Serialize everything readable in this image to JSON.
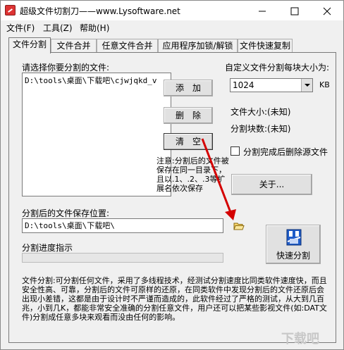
{
  "window": {
    "title": "超级文件切割刀——www.Lysoftware.net",
    "controls": [
      "minimize",
      "maximize",
      "close"
    ]
  },
  "menu": {
    "items": [
      {
        "label": "文件(F)"
      },
      {
        "label": "工具(Z)"
      },
      {
        "label": "帮助(H)"
      }
    ]
  },
  "tabs": [
    {
      "label": "文件分割",
      "active": true
    },
    {
      "label": "文件合并",
      "active": false
    },
    {
      "label": "任意文件合并",
      "active": false
    },
    {
      "label": "应用程序加锁/解锁",
      "active": false
    },
    {
      "label": "文件快速复制",
      "active": false
    }
  ],
  "split_panel": {
    "select_files_label": "请选择你要分割的文件:",
    "file_list": [
      "D:\\tools\\桌面\\下载吧\\cjwjqkd_v"
    ],
    "add_button": "添　加",
    "delete_button": "删　除",
    "clear_button": "清　空",
    "custom_size_label": "自定义文件分割每块大小为:",
    "chunk_size_value": "1024",
    "chunk_size_unit": "KB",
    "file_size_label": "文件大小:(未知)",
    "chunk_count_label": "分割块数:(未知)",
    "delete_source_label": "分割完成后删除源文件",
    "delete_source_checked": false,
    "note_text": "注意:分割后的文件被保存在同一目录下，且以.1、.2、.3等扩展名依次保存",
    "about_button": "关于...",
    "save_location_label": "分割后的文件保存位置:",
    "save_location_value": "D:\\tools\\桌面\\下载吧\\",
    "folder_icon": "folder-open-icon",
    "progress_label": "分割进度指示",
    "progress_value": 0,
    "quick_split_button": "快速分割",
    "quick_split_icon": "file-split-icon",
    "description": "文件分割:可分割任何文件，采用了多线程技术，经测试分割速度比同类软件速度快，而且安全性高、可靠，分割后的文件可原样的还原，在同类软件中发现分割后的文件还原后会出现小差错，这都是由于设计时不严谨而造成的，此软件经过了严格的测试，从大到几百兆，小到几K，都能非常安全准确的分割任意文件，用户还可以把某些影视文件(如:DAT文件)分割成任意多块来观看而没由任何的影响。"
  },
  "overlay": {
    "arrow_color": "#d40000",
    "watermark": "下载吧"
  }
}
